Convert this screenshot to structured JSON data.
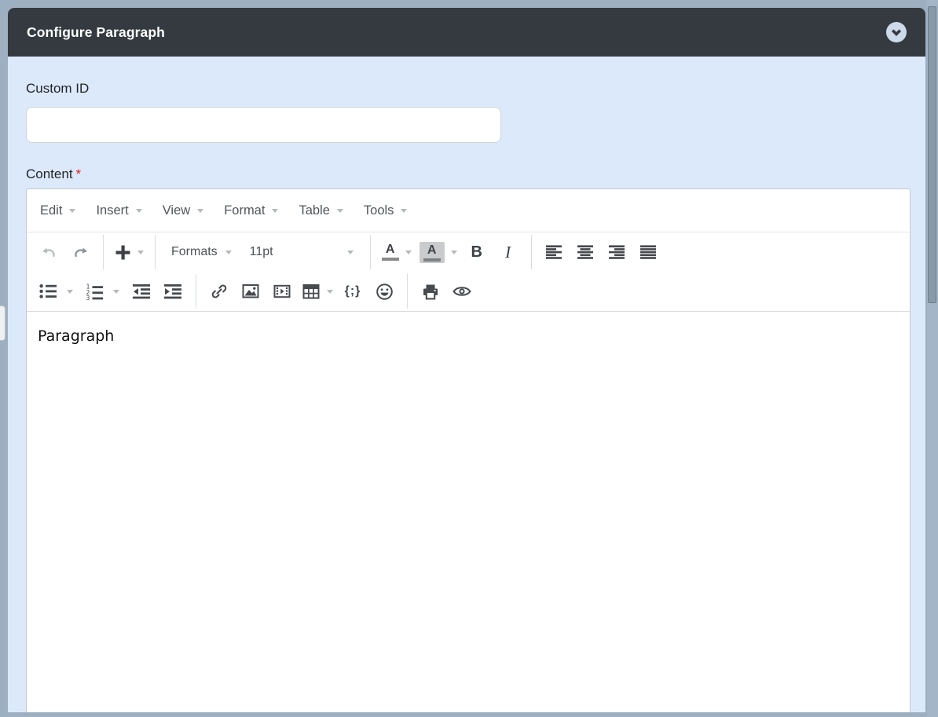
{
  "header": {
    "title": "Configure Paragraph",
    "collapse_icon": "chevron-down-circle-icon"
  },
  "fields": {
    "custom_id": {
      "label": "Custom ID",
      "value": "",
      "placeholder": ""
    },
    "content": {
      "label": "Content",
      "required_marker": "*"
    }
  },
  "editor": {
    "menu_items": [
      {
        "label": "Edit"
      },
      {
        "label": "Insert"
      },
      {
        "label": "View"
      },
      {
        "label": "Format"
      },
      {
        "label": "Table"
      },
      {
        "label": "Tools"
      }
    ],
    "toolbar_row1": {
      "undo_icon": "undo-arrow-icon",
      "redo_icon": "redo-arrow-icon",
      "insert_icon": "plus-icon",
      "formats_label": "Formats",
      "font_size_value": "11pt",
      "text_color_glyph": "A",
      "background_color_glyph": "A",
      "bold_glyph": "B",
      "italic_glyph": "I",
      "align_icons": [
        "align-left-icon",
        "align-center-icon",
        "align-right-icon",
        "align-justify-icon"
      ]
    },
    "toolbar_row2": {
      "bullet_list_icon": "bullet-list-icon",
      "numbered_list_icon": "numbered-list-icon",
      "numbered_list_digits": [
        "1",
        "2",
        "3"
      ],
      "outdent_icon": "outdent-icon",
      "indent_icon": "indent-icon",
      "link_icon": "link-icon",
      "image_icon": "image-icon",
      "media_icon": "media-icon",
      "table_icon": "table-icon",
      "code_sample_glyph": "{;}",
      "emoticons_icon": "emoticon-smiley-icon",
      "print_icon": "printer-icon",
      "preview_icon": "eye-icon"
    },
    "content_text": "Paragraph"
  },
  "colors": {
    "outer_background": "#9db0c1",
    "panel_background": "#dce9fa",
    "header_background": "#343a40",
    "header_text": "#ffffff",
    "required_asterisk": "#e01f1f",
    "toolbar_icon": "#46494e",
    "undo_disabled_icon": "#b9bdc1",
    "redo_icon": "#8c9196",
    "menu_text": "#51575d",
    "caret": "#b4b9bd",
    "editor_border": "#c3c8cd",
    "input_border": "#ced4da",
    "backcolor_highlight": "#c9cbcc",
    "scrollbar_thumb": "#8a99aa",
    "scrollbar_track": "#a3b5c6",
    "collapse_circle": "#ccdaea"
  }
}
